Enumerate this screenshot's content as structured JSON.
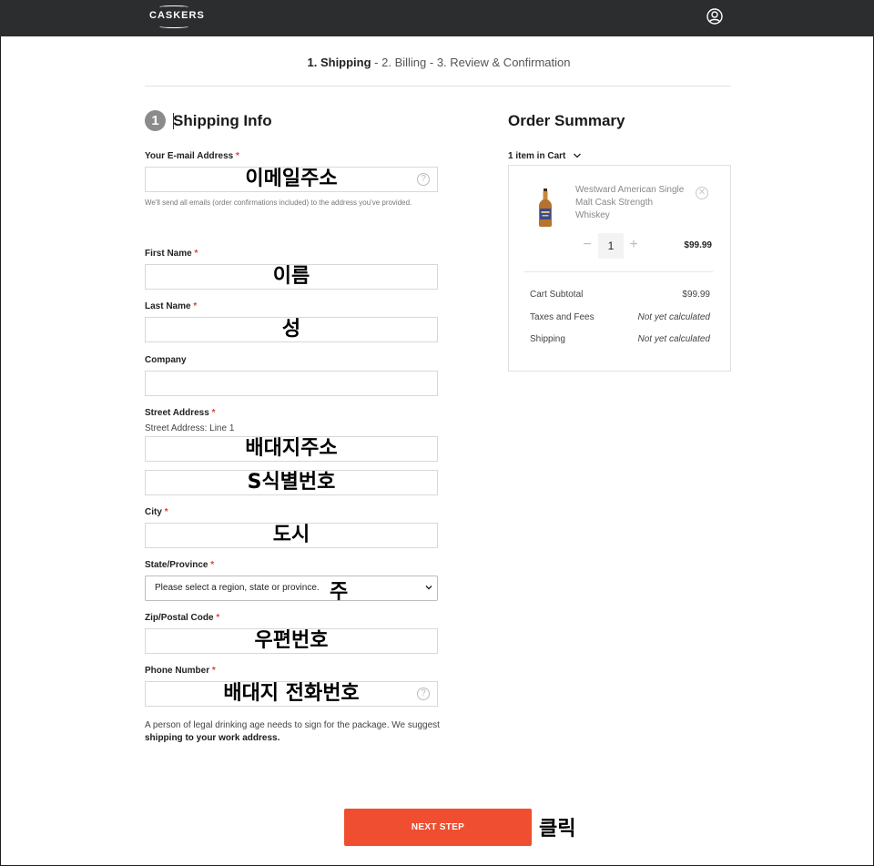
{
  "header": {
    "logo_text": "CASKERS",
    "user_icon": "user-circle-icon",
    "bg_color": "#2b2d2f"
  },
  "steps": {
    "step1": "1.  Shipping",
    "sep1": " - ",
    "step2": "2.  Billing",
    "sep2": " - ",
    "step3": "3.  Review & Confirmation"
  },
  "shipping": {
    "step_number": "1",
    "title": "Shipping Info",
    "required_mark": "*",
    "email": {
      "label": "Your E-mail Address",
      "value": "이메일주소",
      "hint": "We'll send all emails (order confirmations included) to the address you've provided."
    },
    "first_name": {
      "label": "First Name",
      "value": "이름"
    },
    "last_name": {
      "label": "Last Name",
      "value": "성"
    },
    "company": {
      "label": "Company",
      "value": ""
    },
    "street": {
      "label": "Street Address",
      "sublabel": "Street Address: Line 1",
      "line1": "배대지주소",
      "line2": "S식별번호"
    },
    "city": {
      "label": "City",
      "value": "도시"
    },
    "state": {
      "label": "State/Province",
      "placeholder": "Please select a region, state or province.",
      "note": "주"
    },
    "zip": {
      "label": "Zip/Postal Code",
      "value": "우편번호"
    },
    "phone": {
      "label": "Phone Number",
      "value": "배대지 전화번호"
    },
    "legal_text": "A person of legal drinking age needs to sign for the package. We suggest ",
    "legal_bold": "shipping to your work address."
  },
  "summary": {
    "title": "Order Summary",
    "cart_count": "1 item in Cart",
    "product_name": "Westward American Single Malt Cask Strength Whiskey",
    "quantity": "1",
    "price": "$99.99",
    "rows": [
      {
        "label": "Cart Subtotal",
        "value": "$99.99"
      },
      {
        "label": "Taxes and Fees",
        "value": "Not yet calculated"
      },
      {
        "label": "Shipping",
        "value": "Not yet calculated"
      }
    ]
  },
  "actions": {
    "next_label": "NEXT STEP",
    "click_note": "클릭",
    "accent_color": "#ef4e30"
  }
}
